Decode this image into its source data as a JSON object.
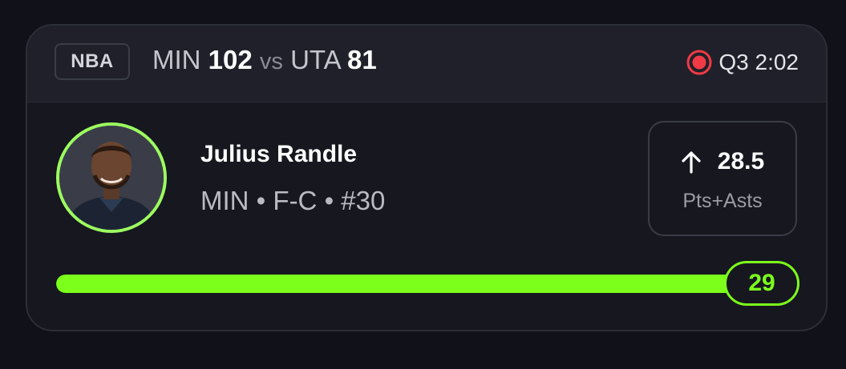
{
  "header": {
    "league": "NBA",
    "home_team": "MIN",
    "home_score": "102",
    "vs": "vs",
    "away_team": "UTA",
    "away_score": "81",
    "period": "Q3",
    "clock": "2:02",
    "live_icon": "live-record-icon",
    "live_color": "#f03a45"
  },
  "player": {
    "name": "Julius Randle",
    "team": "MIN",
    "position": "F-C",
    "number": "#30",
    "separator": "•",
    "avatar_ring_color": "#9cff60"
  },
  "line": {
    "direction_icon": "arrow-up-icon",
    "value": "28.5",
    "stat": "Pts+Asts"
  },
  "progress": {
    "current": "29",
    "fill_fraction": 1.0,
    "accent_color": "#7cff1b"
  }
}
